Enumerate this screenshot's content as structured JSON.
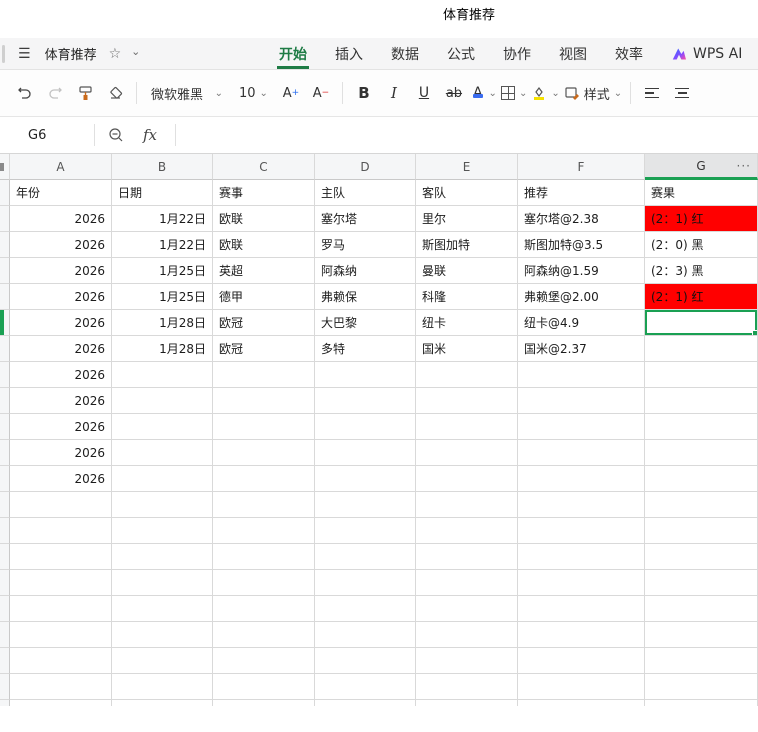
{
  "window": {
    "title": "体育推荐"
  },
  "nav": {
    "doc_name": "体育推荐",
    "tabs": [
      {
        "label": "开始",
        "active": true
      },
      {
        "label": "插入",
        "active": false
      },
      {
        "label": "数据",
        "active": false
      },
      {
        "label": "公式",
        "active": false
      },
      {
        "label": "协作",
        "active": false
      },
      {
        "label": "视图",
        "active": false
      },
      {
        "label": "效率",
        "active": false
      },
      {
        "label": "WPS AI",
        "active": false,
        "logo": true
      }
    ]
  },
  "toolbar": {
    "font_name": "微软雅黑",
    "font_size": "10",
    "bold_label": "B",
    "italic_label": "I",
    "underline_label": "U",
    "strikethrough_label": "ab",
    "font_color_label": "A",
    "styles_label": "样式"
  },
  "formula_bar": {
    "cell_ref": "G6",
    "fx_label": "fx"
  },
  "sheet": {
    "column_headers": [
      "A",
      "B",
      "C",
      "D",
      "E",
      "F",
      "G"
    ],
    "more_label": "···",
    "selected_column": "G",
    "selected_row": 6,
    "rows": [
      [
        "年份",
        "日期",
        "赛事",
        "主队",
        "客队",
        "推荐",
        "赛果"
      ],
      [
        "2026",
        "1月22日",
        "欧联",
        "塞尔塔",
        "里尔",
        "塞尔塔@2.38",
        "(2：1) 红"
      ],
      [
        "2026",
        "1月22日",
        "欧联",
        "罗马",
        "斯图加特",
        "斯图加特@3.5",
        "(2：0) 黑"
      ],
      [
        "2026",
        "1月25日",
        "英超",
        "阿森纳",
        "曼联",
        "阿森纳@1.59",
        "(2：3) 黑"
      ],
      [
        "2026",
        "1月25日",
        "德甲",
        "弗赖保",
        "科隆",
        "弗赖堡@2.00",
        "(2：1) 红"
      ],
      [
        "2026",
        "1月28日",
        "欧冠",
        "大巴黎",
        "纽卡",
        "纽卡@4.9",
        ""
      ],
      [
        "2026",
        "1月28日",
        "欧冠",
        "多特",
        "国米",
        "国米@2.37",
        ""
      ],
      [
        "2026",
        "",
        "",
        "",
        "",
        "",
        ""
      ],
      [
        "2026",
        "",
        "",
        "",
        "",
        "",
        ""
      ],
      [
        "2026",
        "",
        "",
        "",
        "",
        "",
        ""
      ],
      [
        "2026",
        "",
        "",
        "",
        "",
        "",
        ""
      ],
      [
        "2026",
        "",
        "",
        "",
        "",
        "",
        ""
      ]
    ],
    "red_cells": [
      [
        1,
        6
      ],
      [
        4,
        6
      ]
    ],
    "trailing_empty_rows": 9
  },
  "colors": {
    "accent_green": "#1e7b45",
    "selection_green": "#1aa053",
    "result_red": "#ff0000",
    "fill_yellow": "#f5e100",
    "font_color_blue": "#3a6cf0"
  }
}
